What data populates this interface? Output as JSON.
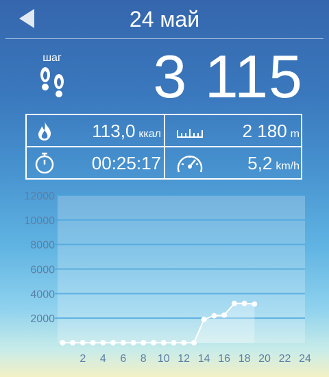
{
  "header": {
    "title": "24 май"
  },
  "steps": {
    "label": "шаг",
    "count": "3 115"
  },
  "stats": {
    "calories": {
      "value": "113,0",
      "unit": "ккал"
    },
    "distance": {
      "value": "2 180",
      "unit": "m"
    },
    "duration": {
      "value": "00:25:17"
    },
    "speed": {
      "value": "5,2",
      "unit": "km/h"
    }
  },
  "chart_data": {
    "type": "line",
    "ylim": [
      0,
      12000
    ],
    "xlim": [
      -0.5,
      24
    ],
    "yticks": [
      2000,
      4000,
      6000,
      8000,
      10000,
      12000
    ],
    "xticks": [
      2,
      4,
      6,
      8,
      10,
      12,
      14,
      16,
      18,
      20,
      22,
      24
    ],
    "x": [
      0,
      1,
      2,
      3,
      4,
      5,
      6,
      7,
      8,
      9,
      10,
      11,
      12,
      13,
      14,
      15,
      16,
      17,
      18,
      19
    ],
    "values": [
      0,
      0,
      0,
      0,
      0,
      0,
      0,
      0,
      0,
      0,
      0,
      0,
      0,
      0,
      1900,
      2200,
      2250,
      3200,
      3200,
      3150
    ],
    "colors": {
      "line": "#ffffff",
      "grid": "#4da6dc",
      "label": "#5a7fa6"
    }
  }
}
